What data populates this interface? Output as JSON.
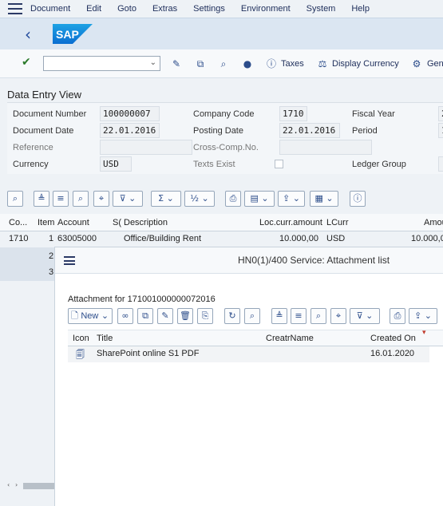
{
  "menu": [
    "Document",
    "Edit",
    "Goto",
    "Extras",
    "Settings",
    "Environment",
    "System",
    "Help"
  ],
  "shell": {
    "logo_text": "SAP"
  },
  "toolbar": {
    "taxes_label": "Taxes",
    "display_currency_label": "Display Currency",
    "gen_label": "Gen"
  },
  "view_title": "Data Entry View",
  "form": {
    "document_number": {
      "label": "Document Number",
      "value": "100000007"
    },
    "company_code": {
      "label": "Company Code",
      "value": "1710"
    },
    "fiscal_year": {
      "label": "Fiscal Year",
      "value": "2"
    },
    "document_date": {
      "label": "Document Date",
      "value": "22.01.2016"
    },
    "posting_date": {
      "label": "Posting Date",
      "value": "22.01.2016"
    },
    "period": {
      "label": "Period",
      "value": "1"
    },
    "reference": {
      "label": "Reference",
      "value": ""
    },
    "cross_comp": {
      "label": "Cross-Comp.No.",
      "value": ""
    },
    "currency": {
      "label": "Currency",
      "value": "USD"
    },
    "texts_exist": {
      "label": "Texts Exist"
    },
    "ledger_group": {
      "label": "Ledger Group",
      "value": ""
    }
  },
  "table": {
    "columns": [
      "Co...",
      "Item",
      "Account",
      "S(",
      "Description",
      "Loc.curr.amount",
      "LCurr",
      "Amou"
    ],
    "rows": [
      {
        "co": "1710",
        "item": "1",
        "account": "63005000",
        "description": "Office/Building Rent",
        "amount": "10.000,00",
        "lcurr": "USD",
        "amou": "10.000,0"
      },
      {
        "item": "2"
      },
      {
        "item": "3"
      }
    ]
  },
  "dialog": {
    "title": "HN0(1)/400 Service: Attachment list",
    "attachment_for": "Attachment for 171001000000072016",
    "new_label": "New",
    "columns": [
      "Icon",
      "Title",
      "CreatrName",
      "Created On"
    ],
    "rows": [
      {
        "title": "SharePoint online S1 PDF",
        "creator": "",
        "created_on": "16.01.2020"
      }
    ]
  }
}
